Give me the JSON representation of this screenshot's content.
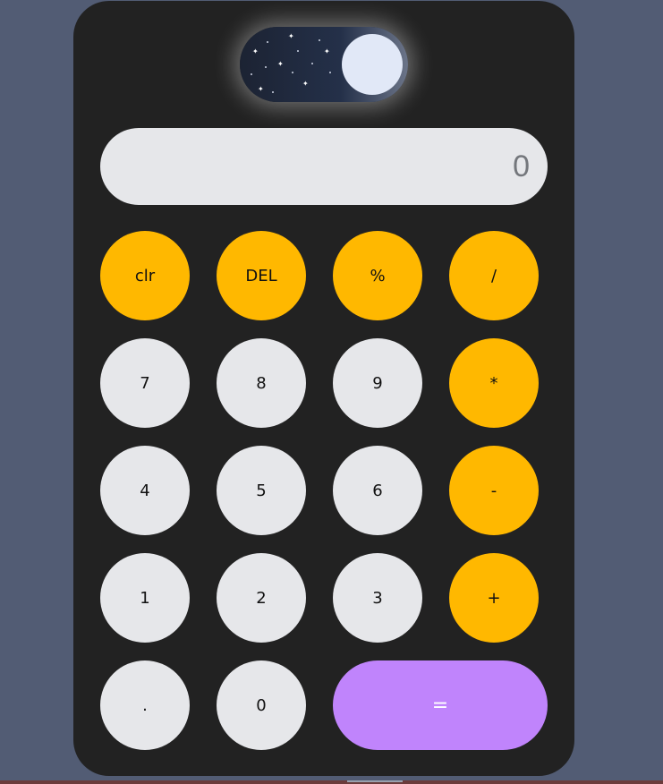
{
  "theme_toggle": {
    "mode": "dark"
  },
  "display": {
    "value": "0"
  },
  "rows": [
    [
      {
        "label": "clr",
        "kind": "op"
      },
      {
        "label": "DEL",
        "kind": "op"
      },
      {
        "label": "%",
        "kind": "op"
      },
      {
        "label": "/",
        "kind": "op"
      }
    ],
    [
      {
        "label": "7",
        "kind": "num"
      },
      {
        "label": "8",
        "kind": "num"
      },
      {
        "label": "9",
        "kind": "num"
      },
      {
        "label": "*",
        "kind": "op"
      }
    ],
    [
      {
        "label": "4",
        "kind": "num"
      },
      {
        "label": "5",
        "kind": "num"
      },
      {
        "label": "6",
        "kind": "num"
      },
      {
        "label": "-",
        "kind": "op"
      }
    ],
    [
      {
        "label": "1",
        "kind": "num"
      },
      {
        "label": "2",
        "kind": "num"
      },
      {
        "label": "3",
        "kind": "num"
      },
      {
        "label": "+",
        "kind": "op"
      }
    ],
    [
      {
        "label": ".",
        "kind": "num"
      },
      {
        "label": "0",
        "kind": "num"
      },
      {
        "label": "=",
        "kind": "equals"
      }
    ]
  ],
  "colors": {
    "page_background": "#525c74",
    "calculator_body": "#222222",
    "number_button": "#e6e7ea",
    "operator_button": "#ffb800",
    "equals_button": "#c084fc",
    "display_text": "#74777c"
  }
}
